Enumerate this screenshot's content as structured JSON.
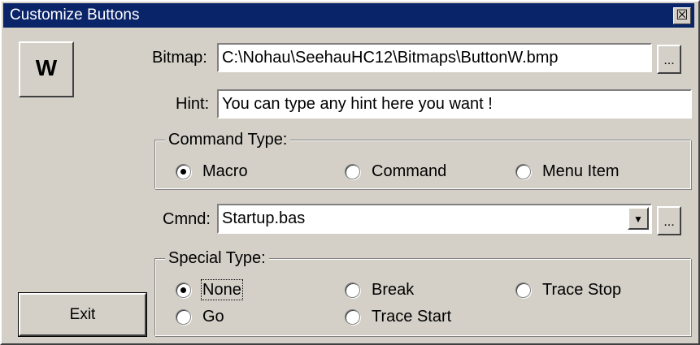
{
  "window": {
    "title": "Customize Buttons",
    "close_glyph": "☒"
  },
  "preview_button": {
    "label": "W"
  },
  "bitmap": {
    "label": "Bitmap:",
    "value": "C:\\Nohau\\SeehauHC12\\Bitmaps\\ButtonW.bmp",
    "browse_label": "..."
  },
  "hint": {
    "label": "Hint:",
    "value": "You can type any hint here you want !"
  },
  "command_type": {
    "title": "Command Type:",
    "options": [
      {
        "label": "Macro",
        "checked": true
      },
      {
        "label": "Command",
        "checked": false
      },
      {
        "label": "Menu Item",
        "checked": false
      }
    ]
  },
  "cmnd": {
    "label": "Cmnd:",
    "value": "Startup.bas",
    "dropdown_glyph": "▼",
    "browse_label": "..."
  },
  "special_type": {
    "title": "Special Type:",
    "options": [
      {
        "label": "None",
        "checked": true
      },
      {
        "label": "Break",
        "checked": false
      },
      {
        "label": "Trace Stop",
        "checked": false
      },
      {
        "label": "Go",
        "checked": false
      },
      {
        "label": "Trace Start",
        "checked": false
      }
    ]
  },
  "exit_button": {
    "label": "Exit"
  },
  "colors": {
    "title_bar": "#0a246a",
    "dialog_face": "#d4d0c8"
  }
}
